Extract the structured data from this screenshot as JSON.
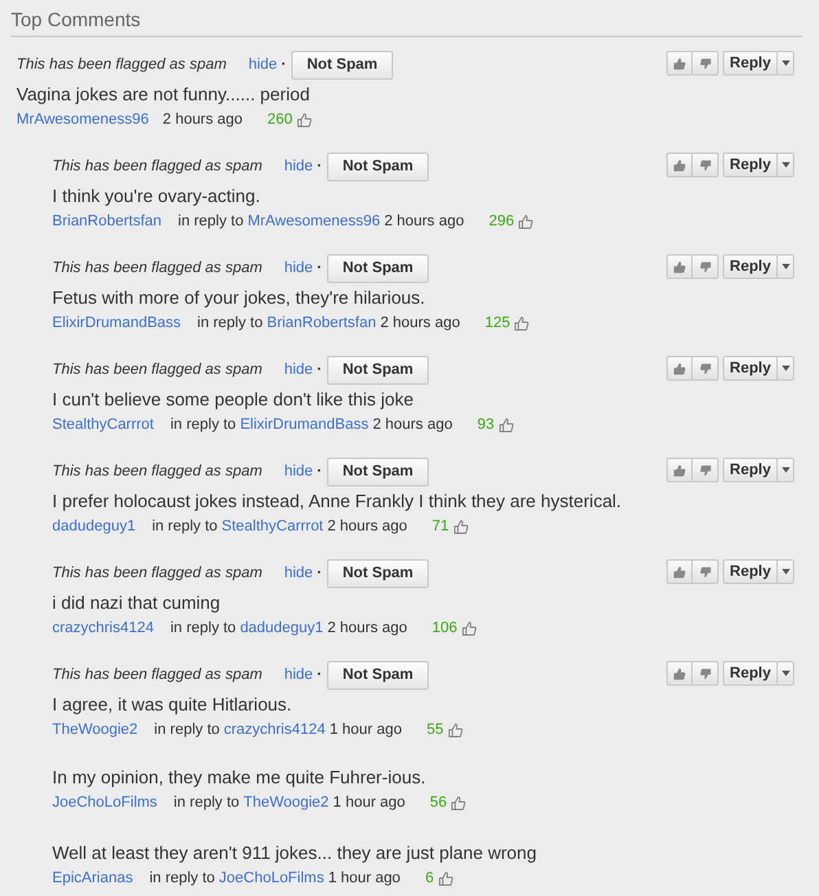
{
  "section_title": "Top Comments",
  "comments": [
    {
      "flag": {
        "text": "This has been flagged as spam",
        "hide": "hide",
        "separator": "·",
        "button": "Not Spam"
      },
      "reply_label": "Reply",
      "text": "Vagina jokes are not funny...... period",
      "author": "MrAwesomeness96",
      "time": "2 hours ago",
      "likes": "260",
      "replies": [
        {
          "flag": {
            "text": "This has been flagged as spam",
            "hide": "hide",
            "separator": "·",
            "button": "Not Spam"
          },
          "reply_label": "Reply",
          "text": "I think you're ovary-acting.",
          "author": "BrianRobertsfan",
          "in_reply_to": {
            "label": "in reply to",
            "name": "MrAwesomeness96"
          },
          "time": "2 hours ago",
          "likes": "296"
        },
        {
          "flag": {
            "text": "This has been flagged as spam",
            "hide": "hide",
            "separator": "·",
            "button": "Not Spam"
          },
          "reply_label": "Reply",
          "text": "Fetus with more of your jokes, they're hilarious.",
          "author": "ElixirDrumandBass",
          "in_reply_to": {
            "label": "in reply to",
            "name": "BrianRobertsfan"
          },
          "time": "2 hours ago",
          "likes": "125"
        },
        {
          "flag": {
            "text": "This has been flagged as spam",
            "hide": "hide",
            "separator": "·",
            "button": "Not Spam"
          },
          "reply_label": "Reply",
          "text": "I cun't believe some people don't like this joke",
          "author": "StealthyCarrrot",
          "in_reply_to": {
            "label": "in reply to",
            "name": "ElixirDrumandBass"
          },
          "time": "2 hours ago",
          "likes": "93"
        },
        {
          "flag": {
            "text": "This has been flagged as spam",
            "hide": "hide",
            "separator": "·",
            "button": "Not Spam"
          },
          "reply_label": "Reply",
          "text": "I prefer holocaust jokes instead, Anne Frankly I think they are hysterical.",
          "author": "dadudeguy1",
          "in_reply_to": {
            "label": "in reply to",
            "name": "StealthyCarrrot"
          },
          "time": "2 hours ago",
          "likes": "71"
        },
        {
          "flag": {
            "text": "This has been flagged as spam",
            "hide": "hide",
            "separator": "·",
            "button": "Not Spam"
          },
          "reply_label": "Reply",
          "text": "i did nazi that cuming",
          "author": "crazychris4124",
          "in_reply_to": {
            "label": "in reply to",
            "name": "dadudeguy1"
          },
          "time": "2 hours ago",
          "likes": "106"
        },
        {
          "flag": {
            "text": "This has been flagged as spam",
            "hide": "hide",
            "separator": "·",
            "button": "Not Spam"
          },
          "reply_label": "Reply",
          "text": "I agree, it was quite Hitlarious.",
          "author": "TheWoogie2",
          "in_reply_to": {
            "label": "in reply to",
            "name": "crazychris4124"
          },
          "time": "1 hour ago",
          "likes": "55"
        },
        {
          "text": "In my opinion, they make me quite Fuhrer-ious.",
          "author": "JoeChoLoFilms",
          "in_reply_to": {
            "label": "in reply to",
            "name": "TheWoogie2"
          },
          "time": "1 hour ago",
          "likes": "56"
        },
        {
          "text": "Well at least they aren't 911 jokes... they are just plane wrong",
          "author": "EpicArianas",
          "in_reply_to": {
            "label": "in reply to",
            "name": "JoeChoLoFilms"
          },
          "time": "1 hour ago",
          "likes": "6"
        }
      ]
    }
  ]
}
